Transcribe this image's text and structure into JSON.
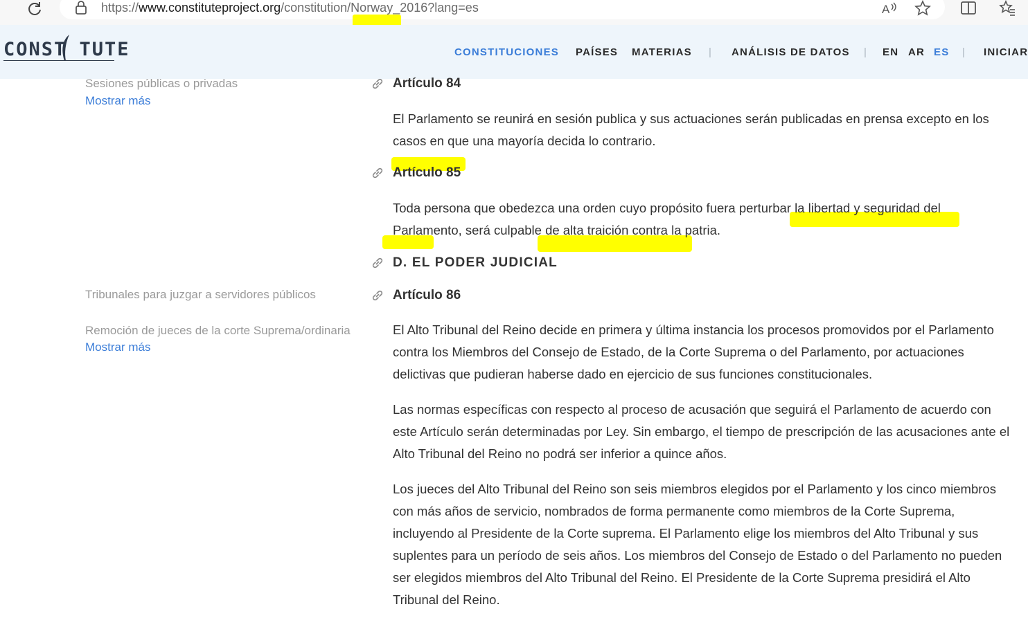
{
  "browser": {
    "url_prefix": "https://",
    "url_domain": "www.constituteproject.org",
    "url_path": "/constitution/Norway_2016?lang=es"
  },
  "header": {
    "logo_text": "CONST TUTE",
    "nav": [
      {
        "label": "CONSTITUCIONES",
        "active": true
      },
      {
        "label": "PAÍSES"
      },
      {
        "label": "MATERIAS"
      },
      {
        "label": "ANÁLISIS DE DATOS"
      },
      {
        "label": "EN"
      },
      {
        "label": "AR"
      },
      {
        "label": "ES",
        "active": true
      },
      {
        "label": "INICIAR"
      }
    ],
    "separator": "|"
  },
  "sidebar": {
    "label1": "Sesiones públicas o privadas",
    "show_more1": "Mostrar más",
    "label2": "Tribunales para juzgar a servidores públicos",
    "label3": "Remoción de jueces de la corte Suprema/ordinaria",
    "show_more2": "Mostrar más"
  },
  "articles": {
    "a84_title": "Artículo 84",
    "a84_text": "El Parlamento se reunirá en sesión publica y sus actuaciones serán publicadas en prensa excepto en los casos en que una mayoría decida lo contrario.",
    "a85_title": "Artículo 85",
    "a85_text": "Toda persona que obedezca una orden cuyo propósito fuera perturbar la libertad y seguridad del Parlamento, será culpable de alta traición contra la patria.",
    "section_d": "D. EL PODER JUDICIAL",
    "a86_title": "Artículo 86",
    "a86_p1": "El Alto Tribunal del Reino decide en primera y última instancia los procesos promovidos por el Parlamento contra los Miembros del Consejo de Estado, de la Corte Suprema o del Parlamento, por actuaciones delictivas que pudieran haberse dado en ejercicio de sus funciones constitucionales.",
    "a86_p2": "Las normas específicas con respecto al proceso de acusación que seguirá el Parlamento de acuerdo con este Artículo serán determinadas por Ley. Sin embargo, el tiempo de prescripción de las acusaciones ante el Alto Tribunal del Reino no podrá ser inferior a quince años.",
    "a86_p3": "Los jueces del Alto Tribunal del Reino son seis miembros elegidos por el Parlamento y los cinco miembros con más años de servicio, nombrados de forma permanente como miembros de la Corte Suprema, incluyendo al Presidente de la Corte suprema. El Parlamento elige los miembros del Alto Tribunal y sus suplentes para un período de seis años. Los miembros del Consejo de Estado o del Parlamento no pueden ser elegidos miembros del Alto Tribunal del Reino. El Presidente de la Corte Suprema presidirá el Alto Tribunal del Reino."
  },
  "colors": {
    "accent": "#3b7dd8",
    "highlight": "#ffff00",
    "header_bg": "#eef5fb"
  }
}
